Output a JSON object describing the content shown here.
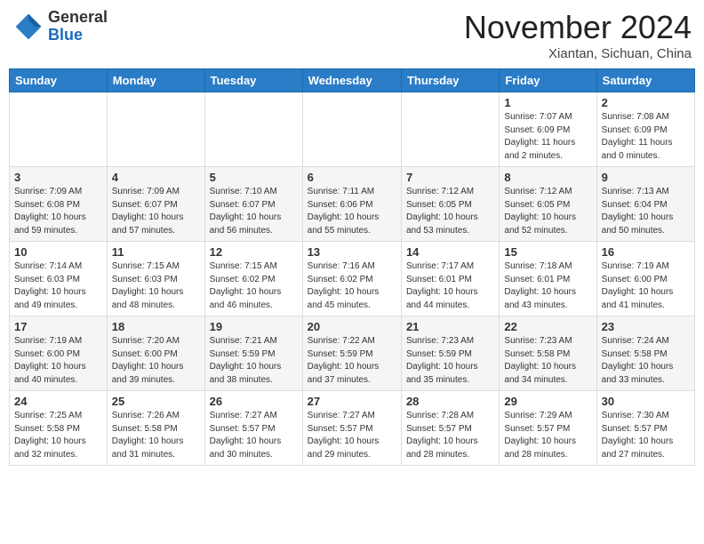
{
  "header": {
    "logo_general": "General",
    "logo_blue": "Blue",
    "month_title": "November 2024",
    "location": "Xiantan, Sichuan, China"
  },
  "days_of_week": [
    "Sunday",
    "Monday",
    "Tuesday",
    "Wednesday",
    "Thursday",
    "Friday",
    "Saturday"
  ],
  "weeks": [
    [
      {
        "day": "",
        "info": ""
      },
      {
        "day": "",
        "info": ""
      },
      {
        "day": "",
        "info": ""
      },
      {
        "day": "",
        "info": ""
      },
      {
        "day": "",
        "info": ""
      },
      {
        "day": "1",
        "info": "Sunrise: 7:07 AM\nSunset: 6:09 PM\nDaylight: 11 hours\nand 2 minutes."
      },
      {
        "day": "2",
        "info": "Sunrise: 7:08 AM\nSunset: 6:09 PM\nDaylight: 11 hours\nand 0 minutes."
      }
    ],
    [
      {
        "day": "3",
        "info": "Sunrise: 7:09 AM\nSunset: 6:08 PM\nDaylight: 10 hours\nand 59 minutes."
      },
      {
        "day": "4",
        "info": "Sunrise: 7:09 AM\nSunset: 6:07 PM\nDaylight: 10 hours\nand 57 minutes."
      },
      {
        "day": "5",
        "info": "Sunrise: 7:10 AM\nSunset: 6:07 PM\nDaylight: 10 hours\nand 56 minutes."
      },
      {
        "day": "6",
        "info": "Sunrise: 7:11 AM\nSunset: 6:06 PM\nDaylight: 10 hours\nand 55 minutes."
      },
      {
        "day": "7",
        "info": "Sunrise: 7:12 AM\nSunset: 6:05 PM\nDaylight: 10 hours\nand 53 minutes."
      },
      {
        "day": "8",
        "info": "Sunrise: 7:12 AM\nSunset: 6:05 PM\nDaylight: 10 hours\nand 52 minutes."
      },
      {
        "day": "9",
        "info": "Sunrise: 7:13 AM\nSunset: 6:04 PM\nDaylight: 10 hours\nand 50 minutes."
      }
    ],
    [
      {
        "day": "10",
        "info": "Sunrise: 7:14 AM\nSunset: 6:03 PM\nDaylight: 10 hours\nand 49 minutes."
      },
      {
        "day": "11",
        "info": "Sunrise: 7:15 AM\nSunset: 6:03 PM\nDaylight: 10 hours\nand 48 minutes."
      },
      {
        "day": "12",
        "info": "Sunrise: 7:15 AM\nSunset: 6:02 PM\nDaylight: 10 hours\nand 46 minutes."
      },
      {
        "day": "13",
        "info": "Sunrise: 7:16 AM\nSunset: 6:02 PM\nDaylight: 10 hours\nand 45 minutes."
      },
      {
        "day": "14",
        "info": "Sunrise: 7:17 AM\nSunset: 6:01 PM\nDaylight: 10 hours\nand 44 minutes."
      },
      {
        "day": "15",
        "info": "Sunrise: 7:18 AM\nSunset: 6:01 PM\nDaylight: 10 hours\nand 43 minutes."
      },
      {
        "day": "16",
        "info": "Sunrise: 7:19 AM\nSunset: 6:00 PM\nDaylight: 10 hours\nand 41 minutes."
      }
    ],
    [
      {
        "day": "17",
        "info": "Sunrise: 7:19 AM\nSunset: 6:00 PM\nDaylight: 10 hours\nand 40 minutes."
      },
      {
        "day": "18",
        "info": "Sunrise: 7:20 AM\nSunset: 6:00 PM\nDaylight: 10 hours\nand 39 minutes."
      },
      {
        "day": "19",
        "info": "Sunrise: 7:21 AM\nSunset: 5:59 PM\nDaylight: 10 hours\nand 38 minutes."
      },
      {
        "day": "20",
        "info": "Sunrise: 7:22 AM\nSunset: 5:59 PM\nDaylight: 10 hours\nand 37 minutes."
      },
      {
        "day": "21",
        "info": "Sunrise: 7:23 AM\nSunset: 5:59 PM\nDaylight: 10 hours\nand 35 minutes."
      },
      {
        "day": "22",
        "info": "Sunrise: 7:23 AM\nSunset: 5:58 PM\nDaylight: 10 hours\nand 34 minutes."
      },
      {
        "day": "23",
        "info": "Sunrise: 7:24 AM\nSunset: 5:58 PM\nDaylight: 10 hours\nand 33 minutes."
      }
    ],
    [
      {
        "day": "24",
        "info": "Sunrise: 7:25 AM\nSunset: 5:58 PM\nDaylight: 10 hours\nand 32 minutes."
      },
      {
        "day": "25",
        "info": "Sunrise: 7:26 AM\nSunset: 5:58 PM\nDaylight: 10 hours\nand 31 minutes."
      },
      {
        "day": "26",
        "info": "Sunrise: 7:27 AM\nSunset: 5:57 PM\nDaylight: 10 hours\nand 30 minutes."
      },
      {
        "day": "27",
        "info": "Sunrise: 7:27 AM\nSunset: 5:57 PM\nDaylight: 10 hours\nand 29 minutes."
      },
      {
        "day": "28",
        "info": "Sunrise: 7:28 AM\nSunset: 5:57 PM\nDaylight: 10 hours\nand 28 minutes."
      },
      {
        "day": "29",
        "info": "Sunrise: 7:29 AM\nSunset: 5:57 PM\nDaylight: 10 hours\nand 28 minutes."
      },
      {
        "day": "30",
        "info": "Sunrise: 7:30 AM\nSunset: 5:57 PM\nDaylight: 10 hours\nand 27 minutes."
      }
    ]
  ]
}
